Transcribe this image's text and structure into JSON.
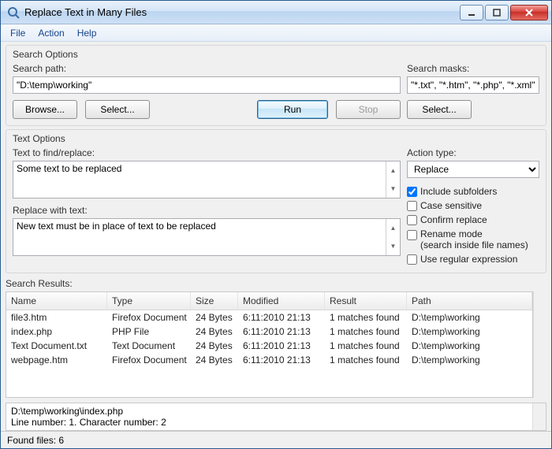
{
  "window": {
    "title": "Replace Text in Many Files"
  },
  "menu": {
    "file": "File",
    "action": "Action",
    "help": "Help"
  },
  "searchOptions": {
    "group_title": "Search Options",
    "search_path_label": "Search path:",
    "search_path_value": "\"D:\\temp\\working\"",
    "search_masks_label": "Search masks:",
    "search_masks_value": "\"*.txt\", \"*.htm\", \"*.php\", \"*.xml\"",
    "browse_btn": "Browse...",
    "select_path_btn": "Select...",
    "run_btn": "Run",
    "stop_btn": "Stop",
    "select_masks_btn": "Select..."
  },
  "textOptions": {
    "group_title": "Text Options",
    "find_label": "Text to find/replace:",
    "find_value": "Some text to be replaced",
    "replace_label": "Replace with text:",
    "replace_value": "New text must be in place of text to be replaced",
    "action_type_label": "Action type:",
    "action_type_value": "Replace",
    "include_subfolders": "Include subfolders",
    "case_sensitive": "Case sensitive",
    "confirm_replace": "Confirm replace",
    "rename_mode_l1": "Rename mode",
    "rename_mode_l2": "(search inside file names)",
    "use_regex": "Use regular expression"
  },
  "results": {
    "title": "Search Results:",
    "columns": {
      "name": "Name",
      "type": "Type",
      "size": "Size",
      "modified": "Modified",
      "result": "Result",
      "path": "Path"
    },
    "rows": [
      {
        "name": "file3.htm",
        "type": "Firefox Document",
        "size": "24 Bytes",
        "modified": "6:11:2010  21:13",
        "result": "1 matches found",
        "path": "D:\\temp\\working"
      },
      {
        "name": "index.php",
        "type": "PHP File",
        "size": "24 Bytes",
        "modified": "6:11:2010  21:13",
        "result": "1 matches found",
        "path": "D:\\temp\\working"
      },
      {
        "name": "Text Document.txt",
        "type": "Text Document",
        "size": "24 Bytes",
        "modified": "6:11:2010  21:13",
        "result": "1 matches found",
        "path": "D:\\temp\\working"
      },
      {
        "name": "webpage.htm",
        "type": "Firefox Document",
        "size": "24 Bytes",
        "modified": "6:11:2010  21:13",
        "result": "1 matches found",
        "path": "D:\\temp\\working"
      }
    ]
  },
  "detail": {
    "line1": "D:\\temp\\working\\index.php",
    "line2": "Line number: 1. Character number: 2"
  },
  "statusbar": {
    "found": "Found files: 6"
  }
}
